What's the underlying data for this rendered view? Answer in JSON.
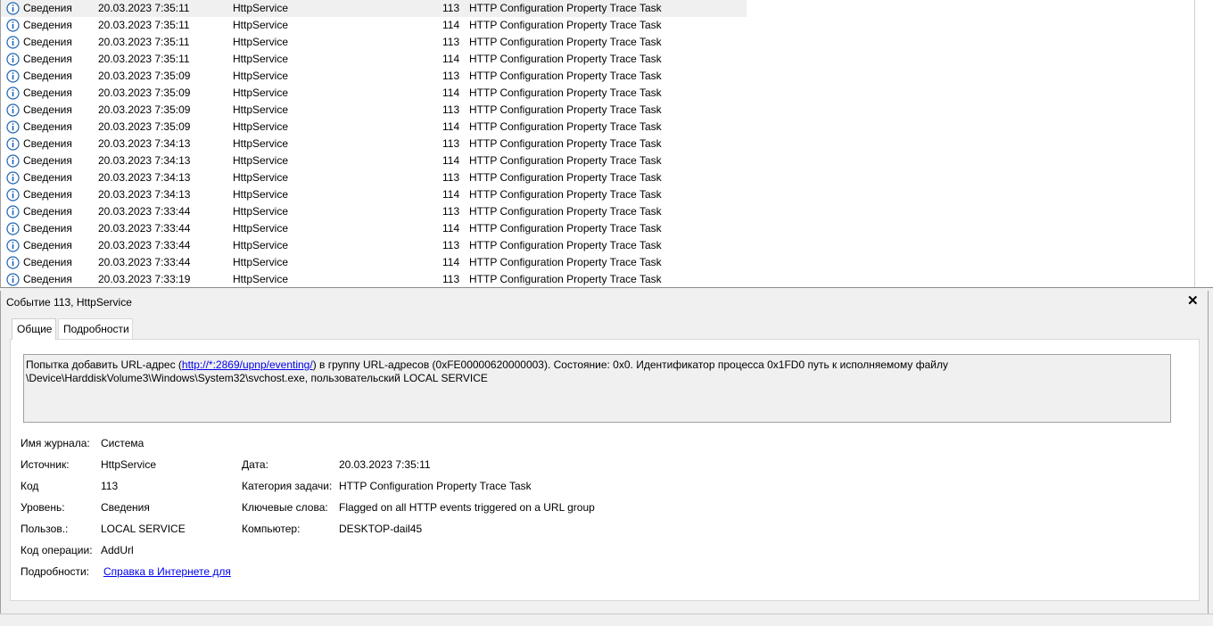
{
  "events": [
    {
      "level": "Сведения",
      "datetime": "20.03.2023 7:35:11",
      "source": "HttpService",
      "code": "113",
      "category": "HTTP Configuration Property Trace Task"
    },
    {
      "level": "Сведения",
      "datetime": "20.03.2023 7:35:11",
      "source": "HttpService",
      "code": "114",
      "category": "HTTP Configuration Property Trace Task"
    },
    {
      "level": "Сведения",
      "datetime": "20.03.2023 7:35:11",
      "source": "HttpService",
      "code": "113",
      "category": "HTTP Configuration Property Trace Task"
    },
    {
      "level": "Сведения",
      "datetime": "20.03.2023 7:35:11",
      "source": "HttpService",
      "code": "114",
      "category": "HTTP Configuration Property Trace Task"
    },
    {
      "level": "Сведения",
      "datetime": "20.03.2023 7:35:09",
      "source": "HttpService",
      "code": "113",
      "category": "HTTP Configuration Property Trace Task"
    },
    {
      "level": "Сведения",
      "datetime": "20.03.2023 7:35:09",
      "source": "HttpService",
      "code": "114",
      "category": "HTTP Configuration Property Trace Task"
    },
    {
      "level": "Сведения",
      "datetime": "20.03.2023 7:35:09",
      "source": "HttpService",
      "code": "113",
      "category": "HTTP Configuration Property Trace Task"
    },
    {
      "level": "Сведения",
      "datetime": "20.03.2023 7:35:09",
      "source": "HttpService",
      "code": "114",
      "category": "HTTP Configuration Property Trace Task"
    },
    {
      "level": "Сведения",
      "datetime": "20.03.2023 7:34:13",
      "source": "HttpService",
      "code": "113",
      "category": "HTTP Configuration Property Trace Task"
    },
    {
      "level": "Сведения",
      "datetime": "20.03.2023 7:34:13",
      "source": "HttpService",
      "code": "114",
      "category": "HTTP Configuration Property Trace Task"
    },
    {
      "level": "Сведения",
      "datetime": "20.03.2023 7:34:13",
      "source": "HttpService",
      "code": "113",
      "category": "HTTP Configuration Property Trace Task"
    },
    {
      "level": "Сведения",
      "datetime": "20.03.2023 7:34:13",
      "source": "HttpService",
      "code": "114",
      "category": "HTTP Configuration Property Trace Task"
    },
    {
      "level": "Сведения",
      "datetime": "20.03.2023 7:33:44",
      "source": "HttpService",
      "code": "113",
      "category": "HTTP Configuration Property Trace Task"
    },
    {
      "level": "Сведения",
      "datetime": "20.03.2023 7:33:44",
      "source": "HttpService",
      "code": "114",
      "category": "HTTP Configuration Property Trace Task"
    },
    {
      "level": "Сведения",
      "datetime": "20.03.2023 7:33:44",
      "source": "HttpService",
      "code": "113",
      "category": "HTTP Configuration Property Trace Task"
    },
    {
      "level": "Сведения",
      "datetime": "20.03.2023 7:33:44",
      "source": "HttpService",
      "code": "114",
      "category": "HTTP Configuration Property Trace Task"
    },
    {
      "level": "Сведения",
      "datetime": "20.03.2023 7:33:19",
      "source": "HttpService",
      "code": "113",
      "category": "HTTP Configuration Property Trace Task"
    }
  ],
  "level_icon": "info-icon",
  "detail": {
    "title": "Событие 113, HttpService",
    "close": "✕",
    "tabs": {
      "general": "Общие",
      "details": "Подробности"
    },
    "message": {
      "before": "Попытка добавить URL-адрес (",
      "link": "http://*:2869/upnp/eventing/",
      "after": ") в группу URL-адресов (0xFE00000620000003). Состояние: 0x0. Идентификатор процесса 0x1FD0 путь к исполняемому файлу \\Device\\HarddiskVolume3\\Windows\\System32\\svchost.exe, пользовательский LOCAL SERVICE"
    },
    "fields": {
      "log_label": "Имя журнала:",
      "log_value": "Система",
      "source_label": "Источник:",
      "source_value": "HttpService",
      "date_label": "Дата:",
      "date_value": "20.03.2023 7:35:11",
      "code_label": "Код",
      "code_value": "113",
      "category_label": "Категория задачи:",
      "category_value": "HTTP Configuration Property Trace Task",
      "level_label": "Уровень:",
      "level_value": "Сведения",
      "keywords_label": "Ключевые слова:",
      "keywords_value": "Flagged on all HTTP events triggered on a URL group",
      "user_label": "Пользов.:",
      "user_value": "LOCAL SERVICE",
      "computer_label": "Компьютер:",
      "computer_value": "DESKTOP-dail45",
      "opcode_label": "Код операции:",
      "opcode_value": "AddUrl",
      "more_label": "Подробности:",
      "more_link": "Справка в Интернете для "
    }
  },
  "colors": {
    "link": "#0000ee",
    "selected_row": "#f0f0f0",
    "icon_blue": "#1e64b4"
  }
}
